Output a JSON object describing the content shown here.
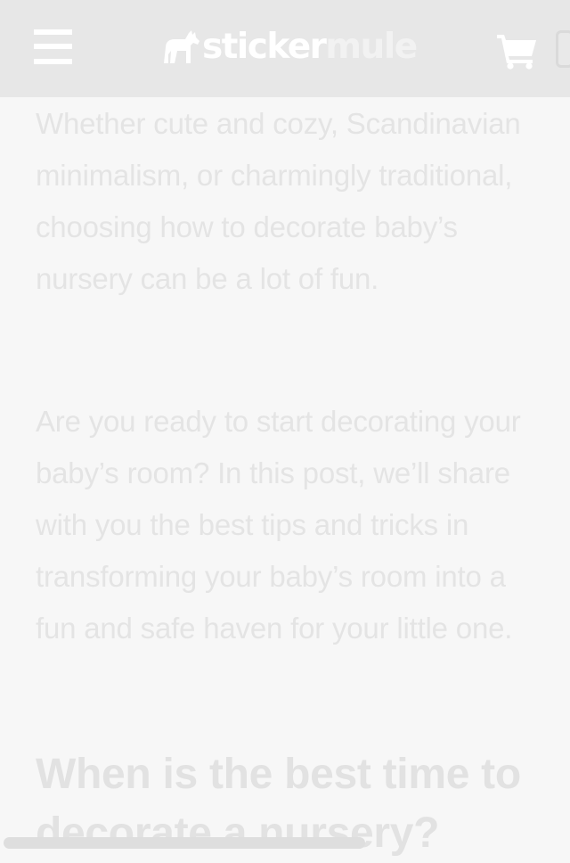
{
  "header": {
    "menu_icon": "hamburger-menu-icon",
    "logo_part1": "sticker",
    "logo_part2": "mule",
    "logo_icon": "mule-silhouette-icon",
    "cart_icon": "shopping-cart-icon",
    "background_color": "#e7e7e7"
  },
  "article": {
    "paragraph1": "Whether cute and cozy, Scandinavian minimalism, or charmingly traditional, choosing how to decorate baby’s nursery can be a lot of fun.",
    "paragraph2": "Are you ready to start decorating your baby’s room? In this post, we’ll share with you the best tips and tricks in transforming your baby’s room into a fun and safe haven for your little one.",
    "heading": "When is the best time to decorate a nursery?"
  }
}
